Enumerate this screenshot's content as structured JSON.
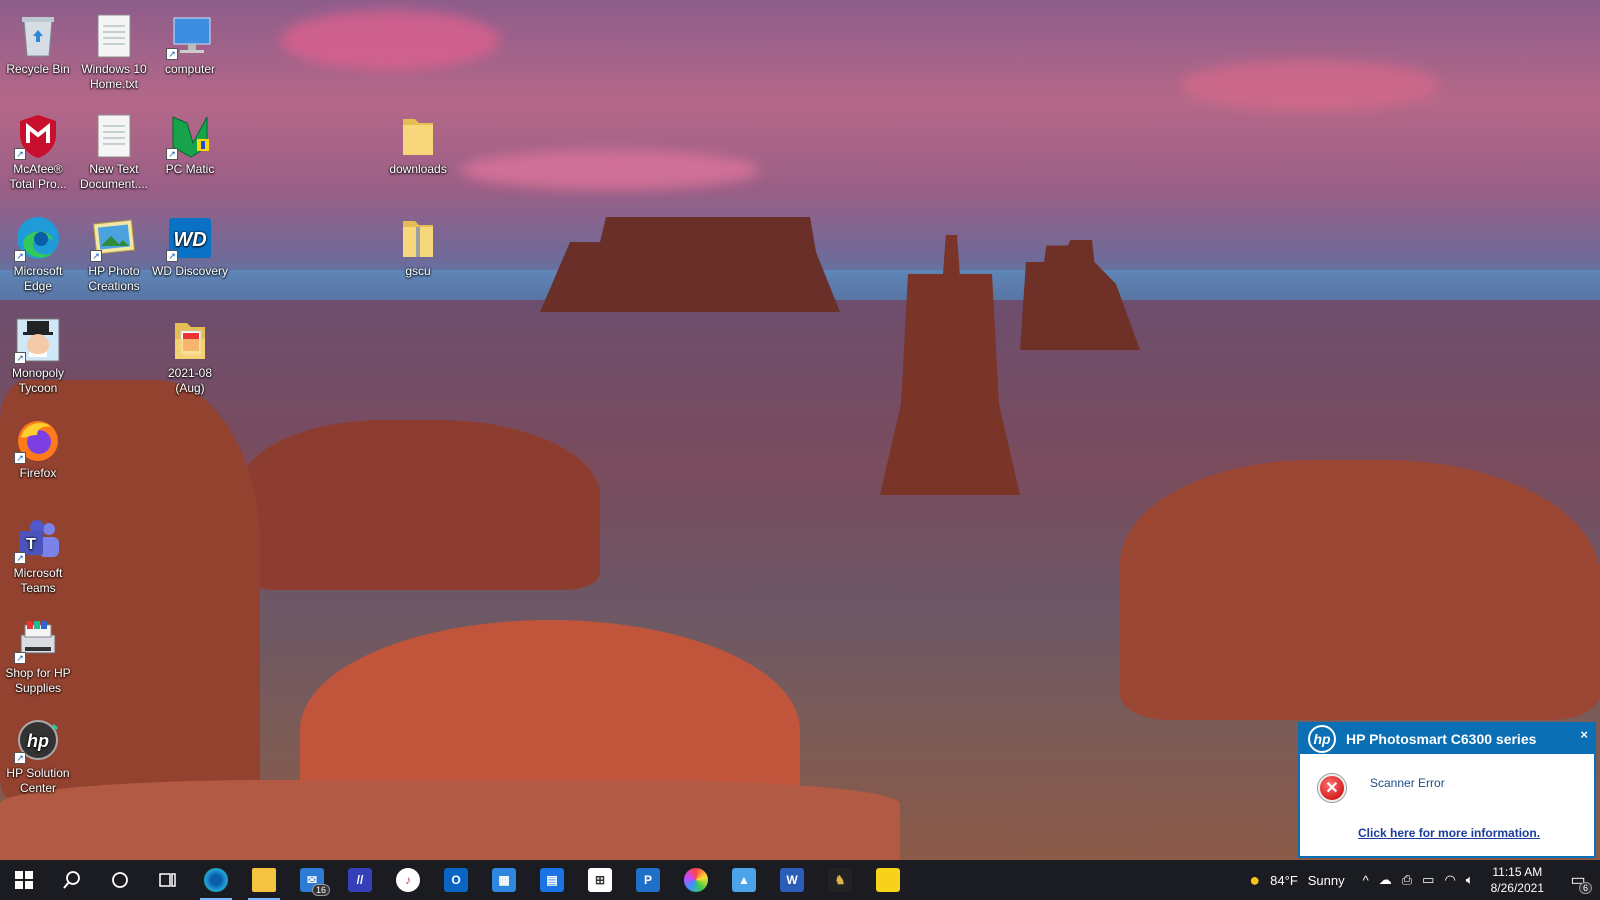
{
  "desktop": {
    "icons": [
      {
        "id": "recycle-bin",
        "label": "Recycle Bin",
        "icon": "recycle-bin-icon"
      },
      {
        "id": "win10-txt",
        "label": "Windows 10 Home.txt",
        "icon": "text-file-icon"
      },
      {
        "id": "computer",
        "label": "computer",
        "icon": "computer-icon"
      },
      {
        "id": "mcafee",
        "label": "McAfee® Total Pro...",
        "icon": "mcafee-icon"
      },
      {
        "id": "new-text",
        "label": "New Text Document....",
        "icon": "text-file-icon"
      },
      {
        "id": "pc-matic",
        "label": "PC Matic",
        "icon": "pc-matic-icon"
      },
      {
        "id": "downloads",
        "label": "downloads",
        "icon": "folder-icon"
      },
      {
        "id": "edge",
        "label": "Microsoft Edge",
        "icon": "edge-icon"
      },
      {
        "id": "hp-photo",
        "label": "HP Photo Creations",
        "icon": "hp-photo-icon"
      },
      {
        "id": "wd",
        "label": "WD Discovery",
        "icon": "wd-icon"
      },
      {
        "id": "gscu",
        "label": "gscu",
        "icon": "zip-folder-icon"
      },
      {
        "id": "monopoly",
        "label": "Monopoly Tycoon",
        "icon": "monopoly-icon"
      },
      {
        "id": "aug-folder",
        "label": "2021-08 (Aug)",
        "icon": "image-folder-icon"
      },
      {
        "id": "firefox",
        "label": "Firefox",
        "icon": "firefox-icon"
      },
      {
        "id": "teams",
        "label": "Microsoft Teams",
        "icon": "teams-icon"
      },
      {
        "id": "hp-supplies",
        "label": "Shop for HP Supplies",
        "icon": "hp-supplies-icon"
      },
      {
        "id": "hp-solution",
        "label": "HP Solution Center",
        "icon": "hp-solution-icon"
      }
    ]
  },
  "taskbar": {
    "mail_badge": "16",
    "word_letter": "W",
    "teams_letter": "T",
    "weather": {
      "temp": "84°F",
      "condition": "Sunny"
    },
    "clock": {
      "time": "11:15 AM",
      "date": "8/26/2021"
    },
    "notifications_count": "6"
  },
  "popup": {
    "title": "HP Photosmart C6300 series",
    "logo": "hp",
    "close": "×",
    "message": "Scanner Error",
    "link": "Click here for more information."
  },
  "colors": {
    "taskbar": "#1b1c22",
    "popup_header": "#0a6fb4",
    "link": "#1a3e9c"
  }
}
